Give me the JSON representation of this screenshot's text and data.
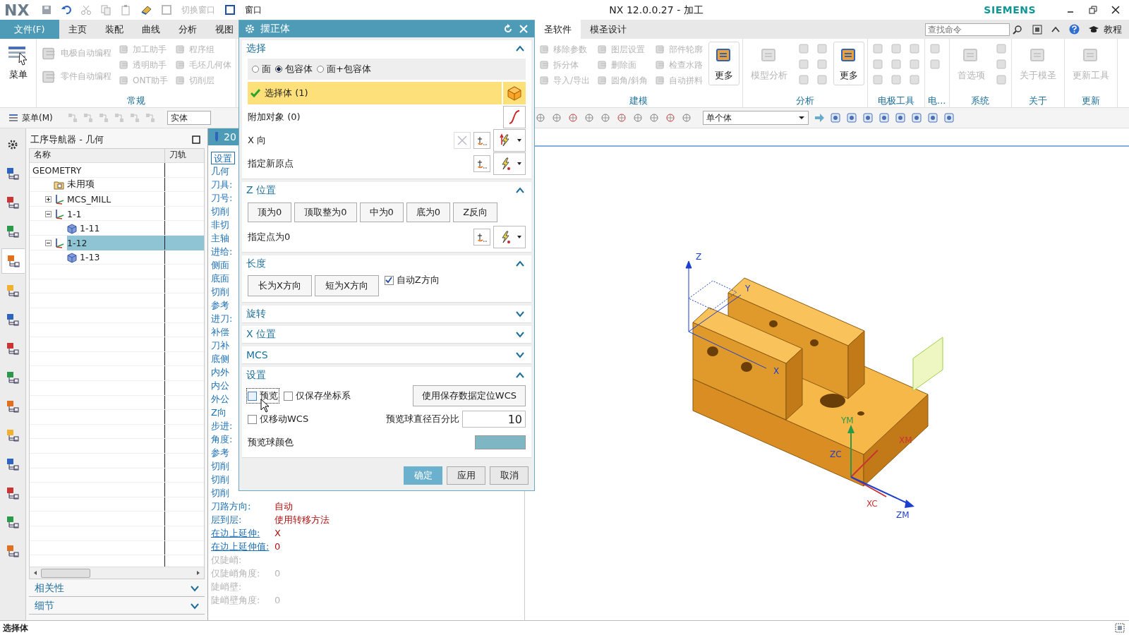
{
  "title_bar": {
    "logo": "NX",
    "commands": [
      {
        "label": "切换窗口",
        "disabled": true
      },
      {
        "label": "窗口",
        "disabled": false
      }
    ],
    "title": "NX 12.0.0.27 - 加工",
    "brand": "SIEMENS"
  },
  "tabs": [
    {
      "label": "文件(F)",
      "kind": "file",
      "selected": false
    },
    {
      "label": "主页",
      "kind": "tab",
      "selected": false
    },
    {
      "label": "装配",
      "kind": "tab",
      "selected": false
    },
    {
      "label": "曲线",
      "kind": "tab",
      "selected": false
    },
    {
      "label": "分析",
      "kind": "tab",
      "selected": false
    },
    {
      "label": "视图",
      "kind": "tab",
      "selected": false
    },
    {
      "label": "圣软件",
      "kind": "tab",
      "selected": true
    },
    {
      "label": "模圣设计",
      "kind": "tab",
      "selected": false
    }
  ],
  "search": {
    "placeholder": "查找命令"
  },
  "help": {
    "label": "教程"
  },
  "ribbon": {
    "menu_button": {
      "label": "菜单"
    },
    "groups": [
      {
        "title": "常规",
        "columns": [
          [
            {
              "label": "电极自动编程",
              "kind": "small",
              "disabled": true
            },
            {
              "label": "零件自动编程",
              "kind": "small",
              "disabled": true
            }
          ],
          [
            {
              "label": "加工助手",
              "kind": "small",
              "disabled": true
            },
            {
              "label": "透明助手",
              "kind": "small",
              "disabled": true
            },
            {
              "label": "ONT助手",
              "kind": "small",
              "disabled": true
            }
          ],
          [
            {
              "label": "程序组",
              "kind": "small",
              "disabled": true
            },
            {
              "label": "毛坯几何体",
              "kind": "small",
              "disabled": true
            },
            {
              "label": "切削层",
              "kind": "small",
              "disabled": true
            }
          ]
        ]
      },
      {
        "title": "建模",
        "columns": [
          [
            {
              "label": "移除参数",
              "kind": "small",
              "disabled": true
            },
            {
              "label": "拆分体",
              "kind": "small",
              "disabled": true
            },
            {
              "label": "导入/导出",
              "kind": "small",
              "disabled": true
            }
          ],
          [
            {
              "label": "图层设置",
              "kind": "small",
              "disabled": true
            },
            {
              "label": "删除面",
              "kind": "small",
              "disabled": true
            },
            {
              "label": "圆角/斜角",
              "kind": "small",
              "disabled": true
            }
          ],
          [
            {
              "label": "部件轮廓",
              "kind": "small",
              "disabled": true
            },
            {
              "label": "检查水路",
              "kind": "small",
              "disabled": true
            },
            {
              "label": "自动拼料",
              "kind": "small",
              "disabled": true
            }
          ],
          [
            {
              "label": "更多",
              "kind": "large",
              "disabled": false
            }
          ]
        ]
      },
      {
        "title": "分析",
        "columns": [
          [
            {
              "label": "模型分析",
              "kind": "large",
              "disabled": true
            }
          ],
          [
            {
              "kind": "icon",
              "disabled": true
            },
            {
              "kind": "icon",
              "disabled": true
            },
            {
              "kind": "icon",
              "disabled": true
            }
          ],
          [
            {
              "kind": "icon",
              "disabled": true
            },
            {
              "kind": "icon",
              "disabled": true
            },
            {
              "kind": "icon",
              "disabled": true
            }
          ],
          [
            {
              "label": "更多",
              "kind": "large",
              "disabled": false
            }
          ]
        ]
      },
      {
        "title": "电极工具",
        "columns": [
          [
            {
              "kind": "icon",
              "disabled": true
            },
            {
              "kind": "icon",
              "disabled": true
            },
            {
              "kind": "icon",
              "disabled": true
            }
          ],
          [
            {
              "kind": "icon",
              "disabled": true
            },
            {
              "kind": "icon",
              "disabled": true
            },
            {
              "kind": "icon",
              "disabled": true
            }
          ],
          [
            {
              "kind": "icon",
              "disabled": true
            },
            {
              "kind": "icon",
              "disabled": true
            },
            {
              "kind": "icon",
              "disabled": true
            }
          ]
        ]
      },
      {
        "title": "电...",
        "columns": [
          [
            {
              "kind": "icon",
              "disabled": true
            },
            {
              "kind": "icon",
              "disabled": true
            }
          ]
        ]
      },
      {
        "title": "系统",
        "columns": [
          [
            {
              "label": "首选项",
              "kind": "large",
              "disabled": true
            }
          ],
          [
            {
              "kind": "icon",
              "disabled": true
            },
            {
              "kind": "icon",
              "disabled": true
            },
            {
              "kind": "icon",
              "disabled": true
            }
          ]
        ]
      },
      {
        "title": "关于",
        "columns": [
          [
            {
              "label": "关于模圣",
              "kind": "large",
              "disabled": true
            }
          ]
        ]
      },
      {
        "title": "更新",
        "columns": [
          [
            {
              "label": "更新工具",
              "kind": "large",
              "disabled": true
            }
          ]
        ]
      }
    ]
  },
  "toolbar": {
    "menu_button": {
      "label": "菜单(M)"
    },
    "filters": [
      {
        "value": "实体"
      },
      {
        "value": "单个体"
      }
    ]
  },
  "resource_bar": [
    {
      "selected": false
    },
    {
      "selected": false
    },
    {
      "selected": false
    },
    {
      "selected": false
    },
    {
      "selected": true
    },
    {
      "selected": false
    },
    {
      "selected": false
    },
    {
      "selected": false
    },
    {
      "selected": false
    },
    {
      "selected": false
    },
    {
      "selected": false
    },
    {
      "selected": false
    },
    {
      "selected": false
    },
    {
      "selected": false
    },
    {
      "selected": false
    }
  ],
  "navigator": {
    "title": "工序导航器 - 几何",
    "columns": [
      "名称",
      "刀轨"
    ],
    "tree": [
      {
        "label": "GEOMETRY",
        "selected": false,
        "children": [
          {
            "label": "未用项",
            "kind": "folder",
            "selected": false
          },
          {
            "label": "MCS_MILL",
            "kind": "mcs",
            "expanded": false,
            "selected": false
          },
          {
            "label": "1-1",
            "kind": "mcs",
            "expanded": true,
            "selected": false,
            "children": [
              {
                "label": "1-11",
                "kind": "workpiece",
                "selected": false
              }
            ]
          },
          {
            "label": "1-12",
            "kind": "mcs",
            "expanded": true,
            "selected": true,
            "children": [
              {
                "label": "1-13",
                "kind": "workpiece",
                "selected": false
              }
            ]
          }
        ]
      }
    ],
    "sections": [
      {
        "label": "相关性",
        "expanded": false
      },
      {
        "label": "细节",
        "expanded": false
      }
    ]
  },
  "info": {
    "tab_label": "20",
    "settings_button": "设置",
    "rows": [
      {
        "label": "几何",
        "kind": "field",
        "disabled": false
      },
      {
        "label": "刀具:",
        "kind": "field",
        "disabled": false
      },
      {
        "label": "刀号:",
        "kind": "field",
        "disabled": false
      },
      {
        "label": "切削",
        "kind": "field",
        "disabled": false
      },
      {
        "label": "非切",
        "kind": "field",
        "disabled": false
      },
      {
        "label": "主轴",
        "kind": "field",
        "disabled": false
      },
      {
        "label": "进给:",
        "kind": "field",
        "disabled": false
      },
      {
        "label": "侧面",
        "kind": "field",
        "disabled": false
      },
      {
        "label": "底面",
        "kind": "field",
        "disabled": false
      },
      {
        "label": "切削",
        "kind": "field",
        "disabled": false
      },
      {
        "label": "参考",
        "kind": "field",
        "disabled": false
      },
      {
        "label": "进刀:",
        "kind": "field",
        "disabled": false
      },
      {
        "label": "补偿",
        "kind": "field",
        "disabled": false
      },
      {
        "label": "刀补",
        "kind": "field",
        "disabled": false
      },
      {
        "label": "底侧",
        "kind": "field",
        "disabled": false
      },
      {
        "label": "内外",
        "kind": "field",
        "disabled": false
      },
      {
        "label": "内公",
        "kind": "field",
        "disabled": false
      },
      {
        "label": "外公",
        "kind": "field",
        "disabled": false
      },
      {
        "label": "Z向",
        "kind": "field",
        "disabled": false
      },
      {
        "label": "步进:",
        "kind": "field",
        "disabled": false
      },
      {
        "label": "角度:",
        "kind": "field",
        "disabled": false
      },
      {
        "label": "参考",
        "kind": "field",
        "disabled": false
      },
      {
        "label": "切削",
        "kind": "field",
        "disabled": false
      },
      {
        "label": "切削",
        "kind": "field",
        "disabled": false
      },
      {
        "label": "切削",
        "kind": "field",
        "disabled": false
      },
      {
        "label": "刀路方向:",
        "value": "自动",
        "kind": "field",
        "disabled": false
      },
      {
        "label": "层到层:",
        "value": "使用转移方法",
        "kind": "field",
        "disabled": false
      },
      {
        "label": "在边上延伸:",
        "value": "X",
        "kind": "link",
        "disabled": false
      },
      {
        "label": "在边上延伸值:",
        "value": "0",
        "kind": "link",
        "disabled": false
      },
      {
        "label": "仅陡峭:",
        "kind": "field",
        "disabled": true
      },
      {
        "label": "仅陡峭角度:",
        "value": "0",
        "kind": "field",
        "disabled": true
      },
      {
        "label": "陡峭壁:",
        "kind": "field",
        "disabled": true
      },
      {
        "label": "陡峭壁角度:",
        "value": "0",
        "kind": "field",
        "disabled": true
      }
    ]
  },
  "dialog": {
    "title": "摆正体",
    "sections": [
      {
        "title": "选择",
        "kind": "select",
        "expanded": true,
        "radios": [
          {
            "label": "面",
            "selected": false
          },
          {
            "label": "包容体",
            "selected": true
          },
          {
            "label": "面+包容体",
            "selected": false
          }
        ],
        "select_row": {
          "label": "选择体 (1)",
          "done": true
        },
        "rows": [
          {
            "label": "附加对象 (0)",
            "kind": "curve"
          },
          {
            "label": "X 向",
            "kind": "vector"
          },
          {
            "label": "指定新原点",
            "kind": "point"
          }
        ]
      },
      {
        "title": "Z 位置",
        "kind": "z_position",
        "expanded": true,
        "buttons": [
          "顶为0",
          "顶取整为0",
          "中为0",
          "底为0",
          "Z反向"
        ],
        "rows": [
          {
            "label": "指定点为0",
            "kind": "point"
          }
        ]
      },
      {
        "title": "长度",
        "kind": "length",
        "expanded": true,
        "buttons": [
          "长为X方向",
          "短为X方向"
        ],
        "checkbox": {
          "label": "自动Z方向",
          "checked": true
        }
      },
      {
        "title": "旋转",
        "expanded": false
      },
      {
        "title": "X 位置",
        "expanded": false
      },
      {
        "title": "MCS",
        "expanded": false
      },
      {
        "title": "设置",
        "kind": "settings",
        "expanded": true,
        "checkboxes": [
          {
            "label": "预览",
            "checked": false
          },
          {
            "label": "仅保存坐标系",
            "checked": false
          },
          {
            "label": "仅移动WCS",
            "checked": false
          }
        ],
        "button": "使用保存数据定位WCS",
        "percent": {
          "label": "预览球直径百分比",
          "value": "10"
        },
        "color": {
          "label": "预览球颜色",
          "color": "#7fb6c4"
        }
      }
    ],
    "buttons": [
      {
        "label": "确定",
        "kind": "primary"
      },
      {
        "label": "应用",
        "kind": "normal"
      },
      {
        "label": "取消",
        "kind": "normal"
      }
    ]
  },
  "view": {
    "wcs_axes": [
      "Z",
      "Y",
      "X"
    ],
    "mcs_axes": [
      "YM",
      "XM",
      "ZC",
      "XC",
      "ZM"
    ]
  },
  "status_bar": {
    "prompt": "选择体"
  }
}
